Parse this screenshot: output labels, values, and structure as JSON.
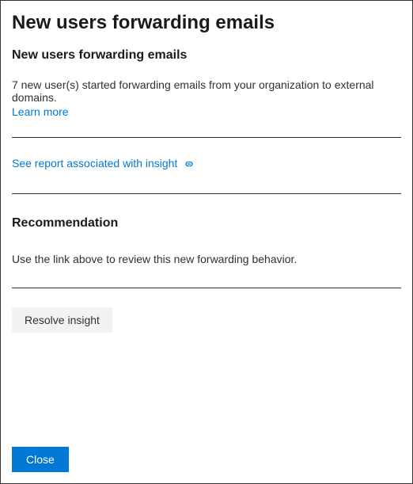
{
  "header": {
    "title": "New users forwarding emails"
  },
  "insight": {
    "section_title": "New users forwarding emails",
    "description": "7 new user(s) started forwarding emails from your organization to external domains.",
    "learn_more_label": "Learn more",
    "report_link_label": "See report associated with insight"
  },
  "recommendation": {
    "section_title": "Recommendation",
    "text": "Use the link above to review this new forwarding behavior."
  },
  "actions": {
    "resolve_label": "Resolve insight",
    "close_label": "Close"
  }
}
